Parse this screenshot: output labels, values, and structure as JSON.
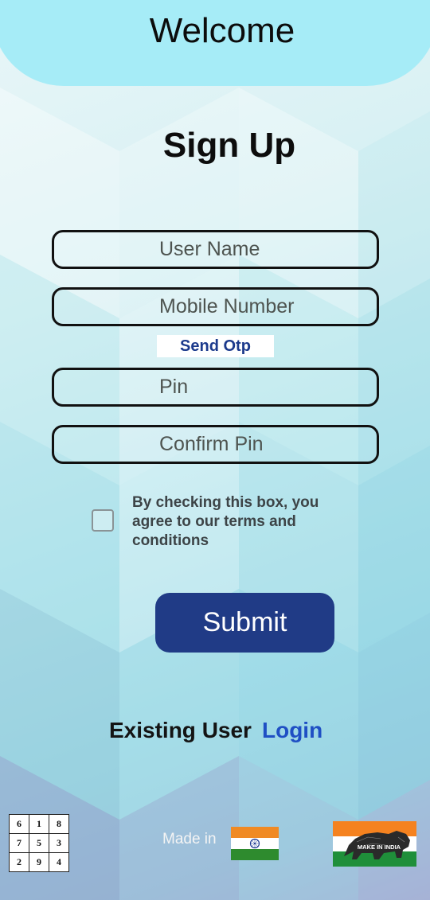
{
  "header": {
    "title": "Welcome"
  },
  "form": {
    "title": "Sign Up",
    "fields": [
      {
        "placeholder": "User Name",
        "value": ""
      },
      {
        "placeholder": "Mobile Number",
        "value": ""
      },
      {
        "placeholder": "Pin",
        "value": ""
      },
      {
        "placeholder": "Confirm Pin",
        "value": ""
      }
    ],
    "send_otp_label": "Send Otp",
    "terms_text": "By checking this box, you agree to our terms and conditions",
    "terms_checked": false,
    "submit_label": "Submit"
  },
  "footer_link": {
    "existing_label": "Existing User",
    "login_label": "Login"
  },
  "bottom": {
    "grid": [
      [
        "6",
        "1",
        "8"
      ],
      [
        "7",
        "5",
        "3"
      ],
      [
        "2",
        "9",
        "4"
      ]
    ],
    "made_in_label": "Made in",
    "flag_icon": "india-flag-icon",
    "badge_text": "MAKE IN INDIA",
    "badge_icon": "make-in-india-lion-icon"
  },
  "colors": {
    "header_bg": "#a6ecf7",
    "submit_bg": "#203b86",
    "otp_text": "#1c3a8c",
    "login_text": "#1f4fc4"
  }
}
